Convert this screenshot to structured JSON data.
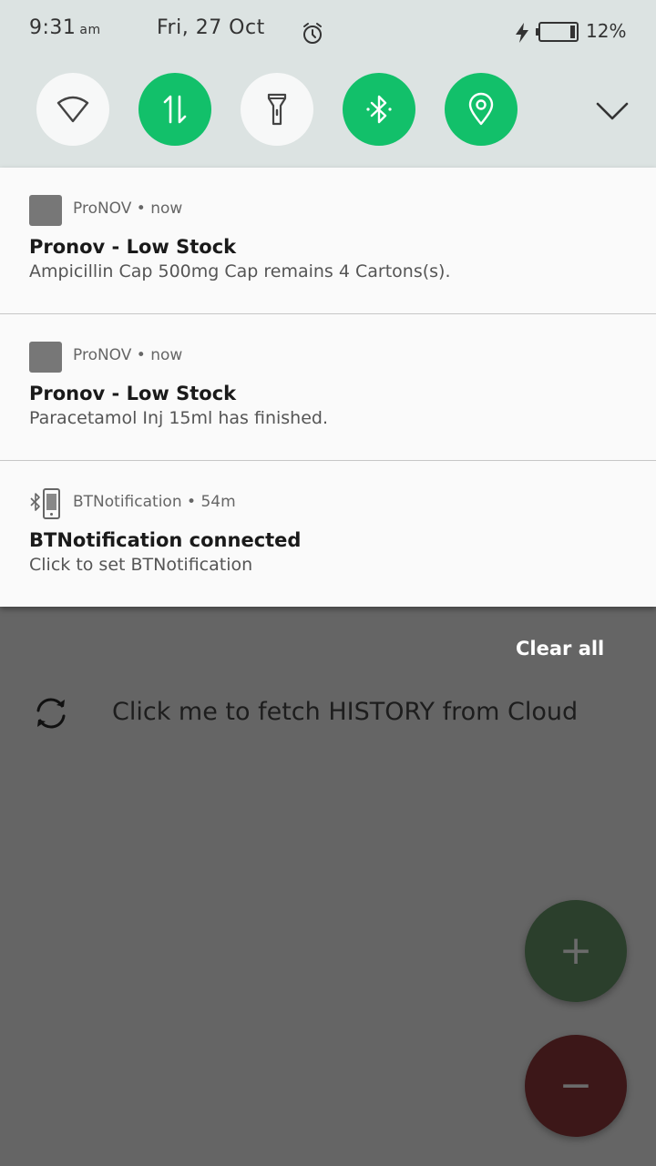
{
  "status_bar": {
    "time": "9:31",
    "ampm": "am",
    "date": "Fri, 27 Oct",
    "battery_percent": "12%",
    "battery_level": 0.12,
    "icons": [
      "alarm-icon",
      "charging-bolt-icon",
      "battery-icon"
    ]
  },
  "quick_settings": {
    "tiles": [
      {
        "name": "wifi",
        "state": "off",
        "icon": "wifi-icon"
      },
      {
        "name": "mobile-data",
        "state": "on",
        "icon": "data-transfer-icon"
      },
      {
        "name": "flashlight",
        "state": "off",
        "icon": "flashlight-icon"
      },
      {
        "name": "bluetooth",
        "state": "on",
        "icon": "bluetooth-icon"
      },
      {
        "name": "location",
        "state": "on",
        "icon": "location-pin-icon"
      }
    ],
    "expand_icon": "chevron-down-icon",
    "active_color": "#12c06a",
    "inactive_color": "#f7f8f8"
  },
  "notifications": [
    {
      "app": "ProNOV",
      "time": "now",
      "title": "Pronov - Low Stock",
      "body": "Ampicillin Cap 500mg Cap remains 4 Cartons(s)."
    },
    {
      "app": "ProNOV",
      "time": "now",
      "title": "Pronov - Low Stock",
      "body": "Paracetamol Inj 15ml has finished."
    },
    {
      "app": "BTNotification",
      "time": "54m",
      "title": "BTNotification connected",
      "body": "Click to set BTNotification"
    }
  ],
  "clear_all_label": "Clear all",
  "app_content": {
    "fetch_label": "Click me to fetch HISTORY from Cloud",
    "fab_add_label": "+",
    "fab_remove_label": "−"
  }
}
